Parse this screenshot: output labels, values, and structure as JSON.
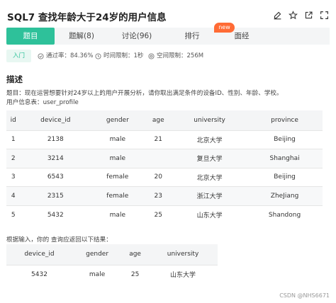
{
  "header": {
    "title": "SQL7  查找年龄大于24岁的用户信息",
    "icons": [
      "edit-icon",
      "star-icon",
      "external-link-icon",
      "fullscreen-icon"
    ]
  },
  "tabs": [
    {
      "label": "题目",
      "active": true
    },
    {
      "label": "题解(8)",
      "active": false
    },
    {
      "label": "讨论(96)",
      "active": false
    },
    {
      "label": "排行",
      "active": false
    },
    {
      "label": "面经",
      "active": false
    }
  ],
  "badge": {
    "label": "new",
    "color": "#ff6b35"
  },
  "meta": {
    "level": "入门",
    "pass_rate": "通过率：84.36%",
    "time_limit": "时间限制：1秒",
    "space_limit": "空间限制：256M"
  },
  "description": {
    "heading": "描述",
    "line1": "题目：现在运营想要针对24岁以上的用户开展分析，请你取出满足条件的设备ID、性别、年龄、学校。",
    "line2": "用户信息表：user_profile"
  },
  "table1": {
    "columns": [
      "id",
      "device_id",
      "gender",
      "age",
      "university",
      "province"
    ],
    "rows": [
      [
        "1",
        "2138",
        "male",
        "21",
        "北京大学",
        "Beijing"
      ],
      [
        "2",
        "3214",
        "male",
        "",
        "复旦大学",
        "Shanghai"
      ],
      [
        "3",
        "6543",
        "female",
        "20",
        "北京大学",
        "Beijing"
      ],
      [
        "4",
        "2315",
        "female",
        "23",
        "浙江大学",
        "ZheJiang"
      ],
      [
        "5",
        "5432",
        "male",
        "25",
        "山东大学",
        "Shandong"
      ]
    ]
  },
  "result": {
    "label": "根据输入，你的 查询应返回以下结果：",
    "columns": [
      "device_id",
      "gender",
      "age",
      "university"
    ],
    "rows": [
      [
        "5432",
        "male",
        "25",
        "山东大学"
      ]
    ]
  },
  "watermark": "CSDN @NHS6671",
  "colors": {
    "accent": "#2ec19a",
    "badge": "#ff6b35"
  }
}
